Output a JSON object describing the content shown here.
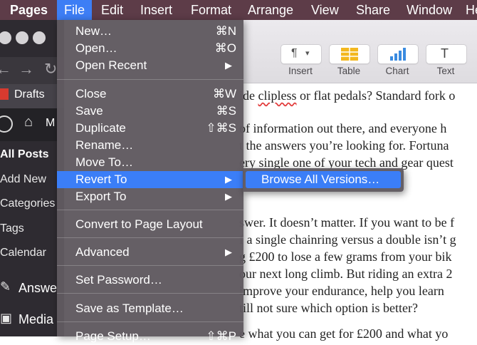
{
  "menubar": {
    "app": "Pages",
    "items": [
      "File",
      "Edit",
      "Insert",
      "Format",
      "Arrange",
      "View",
      "Share",
      "Window",
      "He"
    ]
  },
  "browser": {
    "tab_title": "Drafts",
    "home_letter": "M",
    "sidebar": [
      "All Posts",
      "Add New",
      "Categories",
      "Tags",
      "Calendar",
      "Answe",
      "Media"
    ]
  },
  "pages_toolbar": {
    "buttons": [
      {
        "label": "Insert",
        "icon": "paragraph-icon"
      },
      {
        "label": "Table",
        "icon": "table-icon"
      },
      {
        "label": "Chart",
        "icon": "chart-icon"
      },
      {
        "label": "Text",
        "icon": "text-icon"
      }
    ]
  },
  "document": {
    "lines": [
      "ide clipless or flat pedals? Standard fork o",
      "of information out there, and everyone h",
      "t the answers you’re looking for. Fortuna",
      "ery single one of your tech and gear quest",
      "swer. It doesn’t matter. If you want to be f",
      "f a single chainring versus a double isn’t g",
      "g £200 to lose a few grams from your bik",
      "our next long climb. But riding an extra 2",
      " improve your endurance, help you learn",
      "till not sure which option is better?",
      "e what you can get for £200 and what yo"
    ],
    "misspelled": "clipless"
  },
  "file_menu": {
    "new": {
      "label": "New…",
      "shortcut": "⌘N"
    },
    "open": {
      "label": "Open…",
      "shortcut": "⌘O"
    },
    "open_recent": {
      "label": "Open Recent"
    },
    "close": {
      "label": "Close",
      "shortcut": "⌘W"
    },
    "save": {
      "label": "Save",
      "shortcut": "⌘S"
    },
    "duplicate": {
      "label": "Duplicate",
      "shortcut": "⇧⌘S"
    },
    "rename": {
      "label": "Rename…"
    },
    "move_to": {
      "label": "Move To…"
    },
    "revert_to": {
      "label": "Revert To"
    },
    "export_to": {
      "label": "Export To"
    },
    "convert": {
      "label": "Convert to Page Layout"
    },
    "advanced": {
      "label": "Advanced"
    },
    "set_password": {
      "label": "Set Password…"
    },
    "save_template": {
      "label": "Save as Template…"
    },
    "page_setup": {
      "label": "Page Setup…",
      "shortcut": "⇧⌘P"
    }
  },
  "revert_submenu": {
    "browse_all": "Browse All Versions…"
  }
}
